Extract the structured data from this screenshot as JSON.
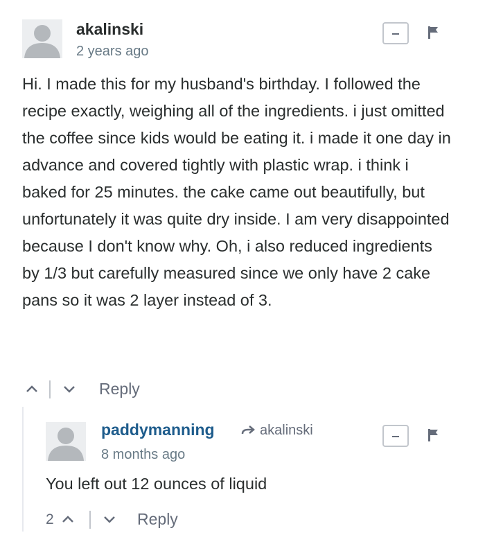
{
  "comments": [
    {
      "author": "akalinski",
      "time": "2 years ago",
      "body": "Hi. I made this for my husband's birthday. I followed the recipe exactly, weighing all of the ingredients. i just omitted the coffee since kids would be eating it. i made it one day in advance and covered tightly with plastic wrap. i think i baked for 25 minutes. the cake came out beautifully, but unfortunately it was quite dry inside. I am very disappointed because I don't know why. Oh, i also reduced ingredients by 1/3 but carefully measured since we only have 2 cake pans so it was 2 layer instead of 3.",
      "reply_label": "Reply"
    },
    {
      "author": "paddymanning",
      "in_reply_to": "akalinski",
      "time": "8 months ago",
      "body": "You left out 12 ounces of liquid",
      "upvotes": "2",
      "reply_label": "Reply"
    }
  ],
  "icons": {
    "avatar": "default-avatar-icon",
    "collapse": "minus-icon",
    "flag": "flag-icon",
    "upvote": "chevron-up-icon",
    "downvote": "chevron-down-icon",
    "reply_arrow": "reply-arrow-icon"
  },
  "colors": {
    "author_primary": "#2a2e2e",
    "author_reply": "#1e5c8c",
    "meta": "#687a86",
    "secondary": "#656c7a"
  }
}
